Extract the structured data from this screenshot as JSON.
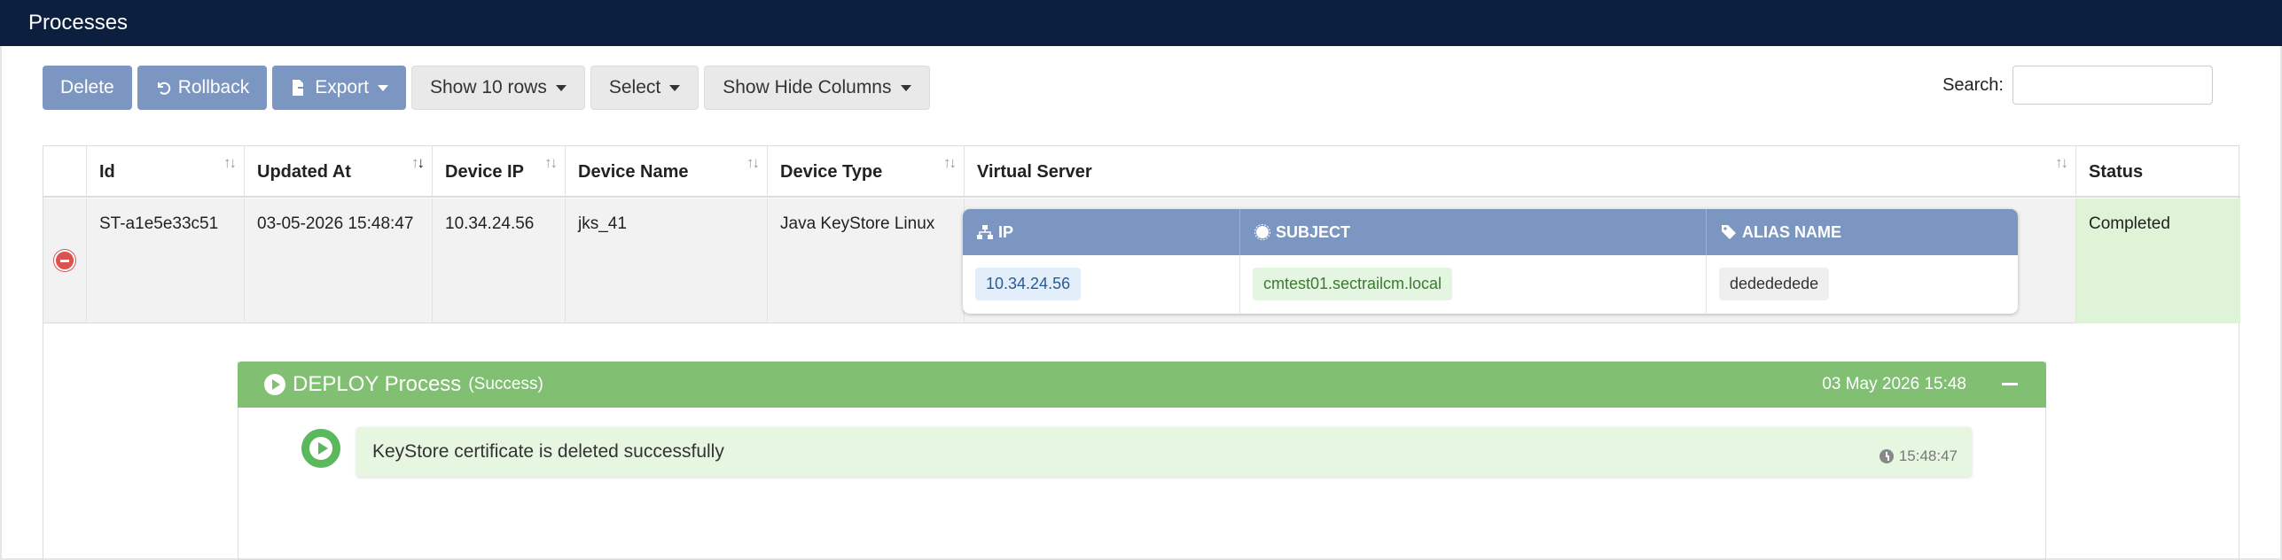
{
  "header": {
    "title": "Processes"
  },
  "toolbar": {
    "delete_label": "Delete",
    "rollback_label": "Rollback",
    "export_label": "Export",
    "show_rows_label": "Show 10 rows",
    "select_label": "Select",
    "show_hide_columns_label": "Show Hide Columns"
  },
  "search": {
    "label": "Search:",
    "value": "",
    "placeholder": ""
  },
  "table": {
    "columns": [
      "Id",
      "Updated At",
      "Device IP",
      "Device Name",
      "Device Type",
      "Virtual Server",
      "Status"
    ],
    "row": {
      "id": "ST-a1e5e33c51",
      "updated_at": "03-05-2026 15:48:47",
      "device_ip": "10.34.24.56",
      "device_name": "jks_41",
      "device_type": "Java KeyStore Linux",
      "status": "Completed",
      "virtual_server": {
        "columns": [
          "IP",
          "SUBJECT",
          "ALIAS NAME"
        ],
        "ip": "10.34.24.56",
        "subject": "cmtest01.sectrailcm.local",
        "alias_name": "dedededede"
      }
    }
  },
  "deploy": {
    "title": "DEPLOY Process",
    "result": "(Success)",
    "date": "03 May 2026 15:48",
    "step_message": "KeyStore certificate is deleted successfully",
    "step_time": "15:48:47"
  },
  "colors": {
    "header_bg": "#0c1f3f",
    "primary_button": "#7b96c1",
    "success_green": "#81bf73",
    "status_bg": "#dff3d6",
    "danger": "#d9534f"
  }
}
